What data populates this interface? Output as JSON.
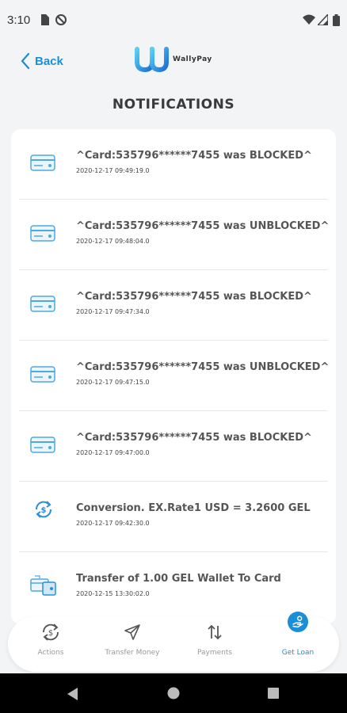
{
  "status_bar": {
    "time": "3:10",
    "left_icons": [
      "sim-card-icon",
      "do-not-disturb-icon"
    ],
    "right_icons": [
      "wifi-icon",
      "cell-signal-icon",
      "battery-icon"
    ]
  },
  "header": {
    "back_label": "Back",
    "logo_text": "WallyPay",
    "title": "NOTIFICATIONS"
  },
  "notifications": [
    {
      "icon": "credit-card-icon",
      "title": "^Card:535796******7455 was BLOCKED^",
      "time": "2020-12-17 09:49:19.0"
    },
    {
      "icon": "credit-card-icon",
      "title": "^Card:535796******7455 was UNBLOCKED^",
      "time": "2020-12-17 09:48:04.0"
    },
    {
      "icon": "credit-card-icon",
      "title": "^Card:535796******7455 was BLOCKED^",
      "time": "2020-12-17 09:47:34.0"
    },
    {
      "icon": "credit-card-icon",
      "title": "^Card:535796******7455 was UNBLOCKED^",
      "time": "2020-12-17 09:47:15.0"
    },
    {
      "icon": "credit-card-icon",
      "title": "^Card:535796******7455 was BLOCKED^",
      "time": "2020-12-17 09:47:00.0"
    },
    {
      "icon": "currency-exchange-icon",
      "title": "Conversion. EX.Rate1 USD = 3.2600 GEL",
      "time": "2020-12-17 09:42:30.0"
    },
    {
      "icon": "wallet-to-card-icon",
      "title": "Transfer of 1.00 GEL Wallet To Card",
      "time": "2020-12-15 13:30:02.0"
    }
  ],
  "bottom_nav": [
    {
      "icon": "dollar-cycle-icon",
      "label": "Actions",
      "active": false
    },
    {
      "icon": "send-icon",
      "label": "Transfer Money",
      "active": false
    },
    {
      "icon": "up-down-arrows-icon",
      "label": "Payments",
      "active": false
    },
    {
      "icon": "loan-hand-icon",
      "label": "Get Loan",
      "active": true
    }
  ],
  "colors": {
    "accent": "#1a8fd6",
    "background": "#f2f4f6",
    "card": "#ffffff",
    "text": "#555555"
  },
  "system_nav": [
    "back-triangle-icon",
    "home-circle-icon",
    "recents-square-icon"
  ]
}
